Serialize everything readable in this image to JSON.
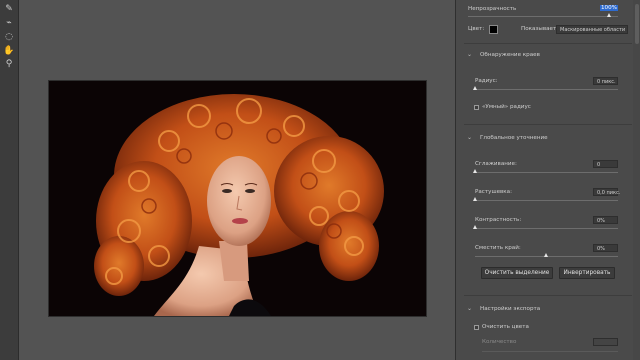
{
  "tools": [
    {
      "name": "brush-icon",
      "glyph": "✎"
    },
    {
      "name": "refine-brush-icon",
      "glyph": "⌁"
    },
    {
      "name": "lasso-icon",
      "glyph": "◌"
    },
    {
      "name": "hand-icon",
      "glyph": "✋"
    },
    {
      "name": "zoom-icon",
      "glyph": "⚲"
    }
  ],
  "panel": {
    "opacity_label": "Непрозрачность",
    "opacity_value": "100%",
    "color_label": "Цвет:",
    "show_label": "Показывает:",
    "show_value": "Маскированные области",
    "edge_section": "Обнаружение краев",
    "radius_label": "Радиус:",
    "radius_value": "0 пикс.",
    "smart_radius_label": "«Умный» радиус",
    "global_section": "Глобальное уточнение",
    "smooth_label": "Сглаживание:",
    "smooth_value": "0",
    "feather_label": "Растушевка:",
    "feather_value": "0,0 пикс.",
    "contrast_label": "Контрастность:",
    "contrast_value": "0%",
    "shift_label": "Сместить край:",
    "shift_value": "0%",
    "clear_button": "Очистить выделение",
    "invert_button": "Инвертировать",
    "export_section": "Настройки экспорта",
    "decontam_label": "Очистить цвета",
    "amount_label": "Количество"
  },
  "colors": {
    "swatch": "#000000",
    "highlight": "#2e6bcf"
  }
}
